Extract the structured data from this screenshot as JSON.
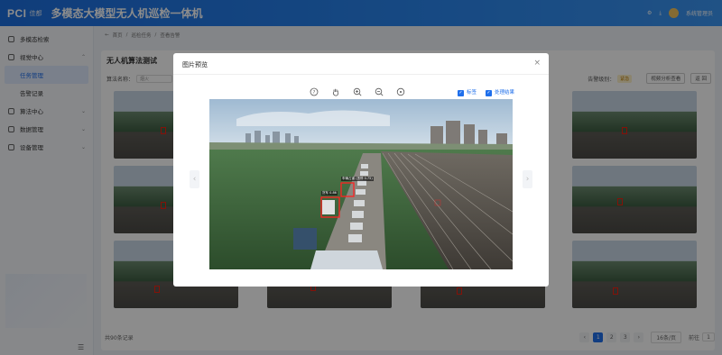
{
  "header": {
    "logo": "PCI",
    "logo_sub": "佳都",
    "title": "多模态大模型无人机巡检一体机",
    "user_name": "系统管理员"
  },
  "sidebar": {
    "items": [
      {
        "label": "多模态检索",
        "icon": "search-icon"
      },
      {
        "label": "视觉中心",
        "icon": "eye-icon",
        "expanded": true
      },
      {
        "label": "任务管理",
        "sub": true,
        "active": true
      },
      {
        "label": "告警记录",
        "sub": true
      },
      {
        "label": "算法中心",
        "icon": "gear-icon"
      },
      {
        "label": "数据管理",
        "icon": "database-icon"
      },
      {
        "label": "设备管理",
        "icon": "device-icon"
      }
    ]
  },
  "breadcrumb": [
    "首页",
    "巡检任务",
    "查看告警"
  ],
  "panel": {
    "title": "无人机算法测试",
    "filter_label": "算法名称：",
    "filter_value": "烟火",
    "alarm_level_label": "告警级别：",
    "alarm_level_value": "紧急",
    "btn_view_analysis": "视频分析查看",
    "btn_back": "返 回"
  },
  "pager": {
    "total": "共90条记录",
    "pages": [
      "1",
      "2",
      "3"
    ],
    "active_page": "1",
    "page_size": "16条/页",
    "goto_label": "前往",
    "goto_value": "1"
  },
  "dialog": {
    "title": "图片预览",
    "close": "×",
    "checkbox_label": "标签",
    "checkbox_result": "处理结果",
    "detections": [
      {
        "label": "车辆占道 (违停 0.75)"
      },
      {
        "label": "货车 0.86"
      }
    ]
  },
  "colors": {
    "primary": "#1f6feb",
    "alarm": "#e21b1b"
  }
}
